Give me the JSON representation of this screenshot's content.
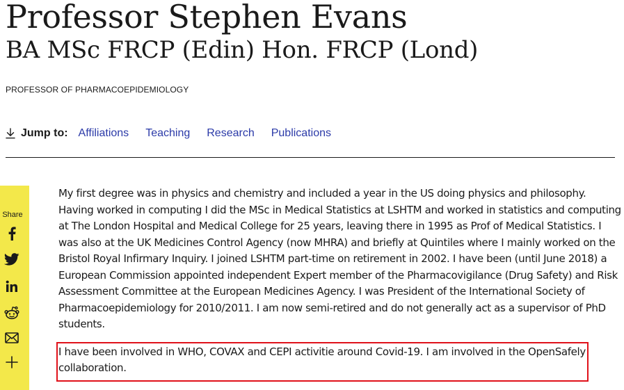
{
  "profile": {
    "name": "Professor Stephen Evans",
    "postnominals": "BA MSc FRCP (Edin) Hon. FRCP (Lond)",
    "role": "PROFESSOR OF PHARMACOEPIDEMIOLOGY"
  },
  "jump": {
    "icon": "download-arrow-icon",
    "label": "Jump to:",
    "links": [
      "Affiliations",
      "Teaching",
      "Research",
      "Publications"
    ]
  },
  "share": {
    "label": "Share",
    "background": "#f3e84a",
    "buttons": [
      "facebook-icon",
      "twitter-icon",
      "linkedin-icon",
      "reddit-icon",
      "email-icon",
      "plus-icon"
    ]
  },
  "bio": {
    "paragraph1": "My first degree was in physics and chemistry and included a year in the US doing physics and philosophy. Having worked in computing I did the MSc in Medical Statistics at LSHTM and worked in statistics and computing at The London Hospital and Medical College for 25 years, leaving there in 1995 as Prof of Medical Statistics. I was also at the UK Medicines Control Agency (now MHRA) and briefly at Quintiles where I mainly worked on the Bristol Royal Infirmary Inquiry. I joined LSHTM part-time on retirement in 2002. I have been (until June 2018) a European Commission appointed independent Expert member of the Pharmacovigilance (Drug Safety) and Risk Assessment Committee at the European Medicines Agency. I was President of the International Society of Pharmacoepidemiology for 2010/2011.  I am now semi-retired and do not generally act as a supervisor of PhD students.",
    "paragraph2": "I have been involved in WHO, COVAX and CEPI activitie around Covid-19. I am involved in the OpenSafely collaboration."
  },
  "colors": {
    "link": "#2b3aa8",
    "highlight": "#e0111a",
    "share_bar": "#f3e84a"
  }
}
